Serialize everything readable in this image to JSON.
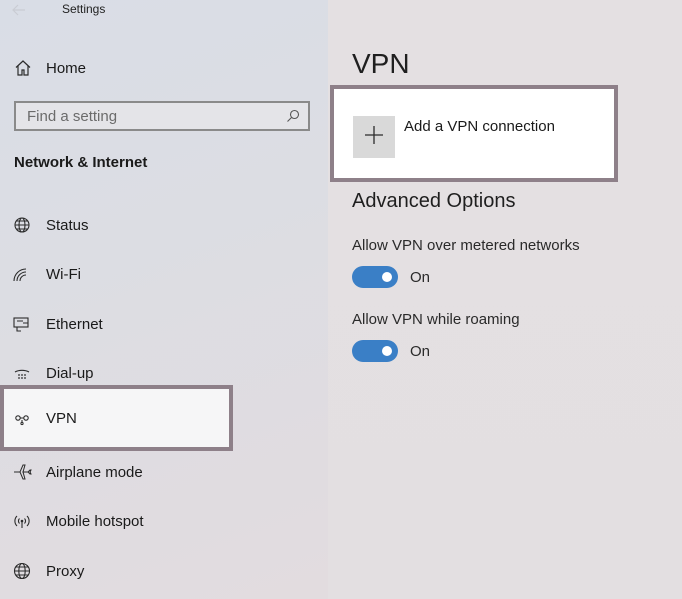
{
  "window": {
    "title": "Settings"
  },
  "sidebar": {
    "home_label": "Home",
    "search_placeholder": "Find a setting",
    "section_header": "Network & Internet",
    "items": [
      {
        "label": "Status",
        "icon": "globe-status-icon"
      },
      {
        "label": "Wi-Fi",
        "icon": "wifi-icon"
      },
      {
        "label": "Ethernet",
        "icon": "ethernet-icon"
      },
      {
        "label": "Dial-up",
        "icon": "dial-up-icon"
      },
      {
        "label": "VPN",
        "icon": "vpn-icon",
        "selected": true
      },
      {
        "label": "Airplane mode",
        "icon": "airplane-icon"
      },
      {
        "label": "Mobile hotspot",
        "icon": "hotspot-icon"
      },
      {
        "label": "Proxy",
        "icon": "globe-icon"
      }
    ]
  },
  "main": {
    "title": "VPN",
    "add_connection_label": "Add a VPN connection",
    "advanced_title": "Advanced Options",
    "options": [
      {
        "label": "Allow VPN over metered networks",
        "state": "On",
        "enabled": true
      },
      {
        "label": "Allow VPN while roaming",
        "state": "On",
        "enabled": true
      }
    ]
  },
  "colors": {
    "accent": "#3a7fc6",
    "highlight_border": "#8e8089"
  }
}
